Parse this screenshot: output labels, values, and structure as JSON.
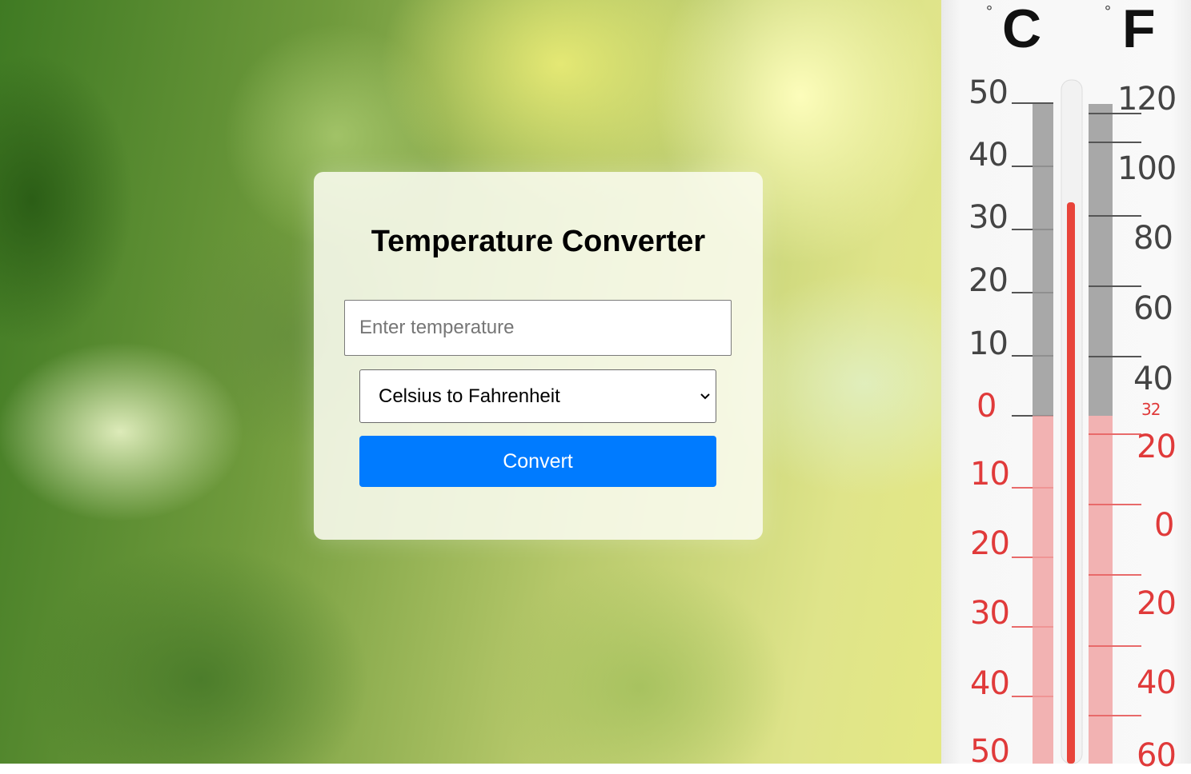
{
  "card": {
    "title": "Temperature Converter",
    "temperature_input": {
      "value": "",
      "placeholder": "Enter temperature"
    },
    "conversion_select": {
      "selected": "Celsius to Fahrenheit"
    },
    "convert_label": "Convert"
  },
  "thermometer": {
    "celsius_unit": "C",
    "fahrenheit_unit": "F",
    "degree_symbol": "°",
    "celsius_labels_above": [
      "50",
      "40",
      "30",
      "20",
      "10"
    ],
    "celsius_zero": "0",
    "celsius_labels_below": [
      "10",
      "20",
      "30",
      "40",
      "50"
    ],
    "fahrenheit_labels_above": [
      "120",
      "100",
      "80",
      "60",
      "40"
    ],
    "fahrenheit_freezing": "32",
    "fahrenheit_labels_below": [
      "20",
      "0",
      "20",
      "40",
      "60"
    ],
    "colors": {
      "scale_above": "#444444",
      "scale_below": "#e03a3a",
      "mercury": "#e8443a"
    }
  },
  "colors": {
    "button": "#007bff",
    "button_text": "#ffffff"
  }
}
